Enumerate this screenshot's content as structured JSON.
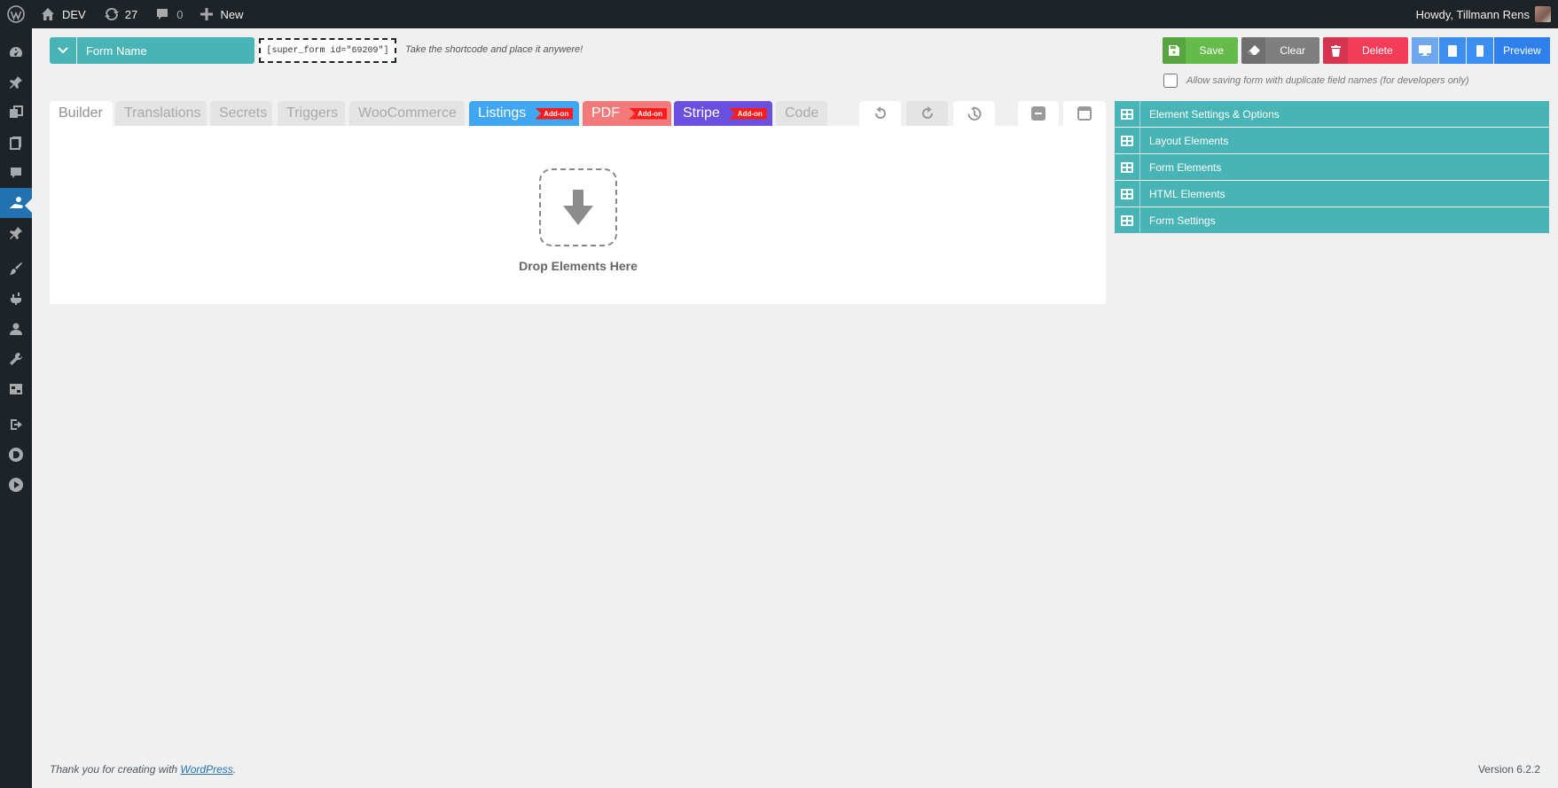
{
  "adminbar": {
    "site_name": "DEV",
    "updates_count": "27",
    "comments_count": "0",
    "new_label": "New",
    "greeting": "Howdy, Tillmann Rens"
  },
  "sidebar": {
    "icons": [
      "dashboard-icon",
      "pin-icon",
      "media-icon",
      "pages-icon",
      "comments-icon",
      "super-forms-icon",
      "pin-icon",
      "appearance-icon",
      "plugins-icon",
      "users-icon",
      "tools-icon",
      "settings-icon",
      "export-icon",
      "divi-icon",
      "play-icon"
    ],
    "active_index": 5
  },
  "form": {
    "name_placeholder": "Form Name",
    "shortcode": "[super_form id=\"69209\"]",
    "shortcode_hint": "Take the shortcode and place it anywere!"
  },
  "actions": {
    "save": "Save",
    "clear": "Clear",
    "delete": "Delete",
    "preview": "Preview",
    "duplicate_names": "Allow saving form with duplicate field names (for developers only)"
  },
  "tabs": [
    {
      "label": "Builder"
    },
    {
      "label": "Translations"
    },
    {
      "label": "Secrets"
    },
    {
      "label": "Triggers"
    },
    {
      "label": "WooCommerce"
    },
    {
      "label": "Listings",
      "badge": "Add-on",
      "color": "#3fa7f2"
    },
    {
      "label": "PDF",
      "badge": "Add-on",
      "color": "#f47a7a"
    },
    {
      "label": "Stripe",
      "badge": "Add-on",
      "color": "#6a4fe0"
    },
    {
      "label": "Code"
    }
  ],
  "canvas": {
    "drop_label": "Drop Elements Here"
  },
  "panel": {
    "items": [
      "Element Settings & Options",
      "Layout Elements",
      "Form Elements",
      "HTML Elements",
      "Form Settings"
    ]
  },
  "footer": {
    "thanks_prefix": "Thank you for creating with ",
    "wordpress_link": "WordPress",
    "thanks_suffix": ".",
    "version": "Version 6.2.2"
  },
  "colors": {
    "accent_teal": "#49b4b6",
    "save_green": "#64bb4a",
    "clear_gray": "#7f7f7f",
    "delete_red": "#f23c5a",
    "preview_blue": "#2f80ed",
    "adminbar_dark": "#1d2327"
  }
}
